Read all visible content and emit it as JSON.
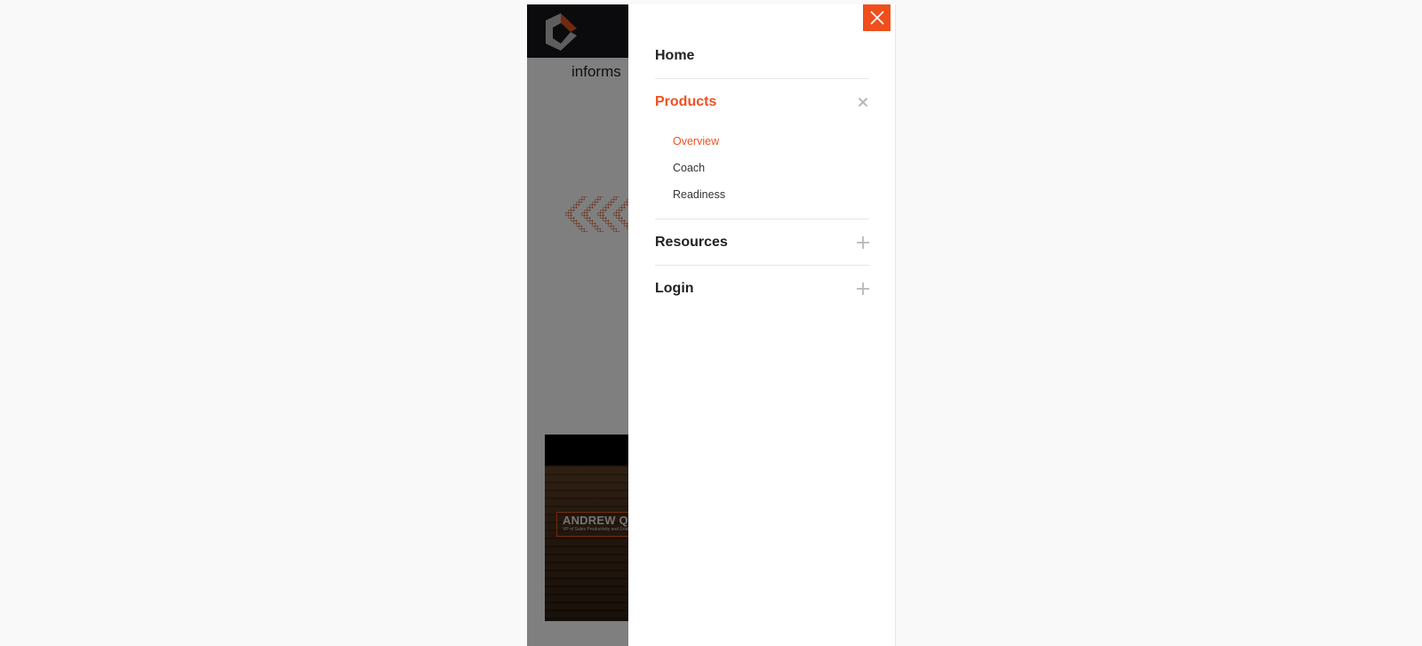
{
  "page": {
    "intro_text": "informs",
    "video": {
      "name_title": "ANDREW QU",
      "name_subtitle": "VP of Sales Productivity and Enablement"
    }
  },
  "menu": {
    "items": [
      {
        "label": "Home",
        "expanded": false
      },
      {
        "label": "Products",
        "expanded": true,
        "toggle_icon": "close-icon",
        "children": [
          {
            "label": "Overview",
            "active": true
          },
          {
            "label": "Coach",
            "active": false
          },
          {
            "label": "Readiness",
            "active": false
          }
        ]
      },
      {
        "label": "Resources",
        "expanded": false,
        "toggle_icon": "plus-icon"
      },
      {
        "label": "Login",
        "expanded": false,
        "toggle_icon": "plus-icon"
      }
    ]
  },
  "colors": {
    "accent": "#ef5120",
    "header_bg": "#16171a",
    "overlay": "rgba(0,0,0,0.5)"
  }
}
